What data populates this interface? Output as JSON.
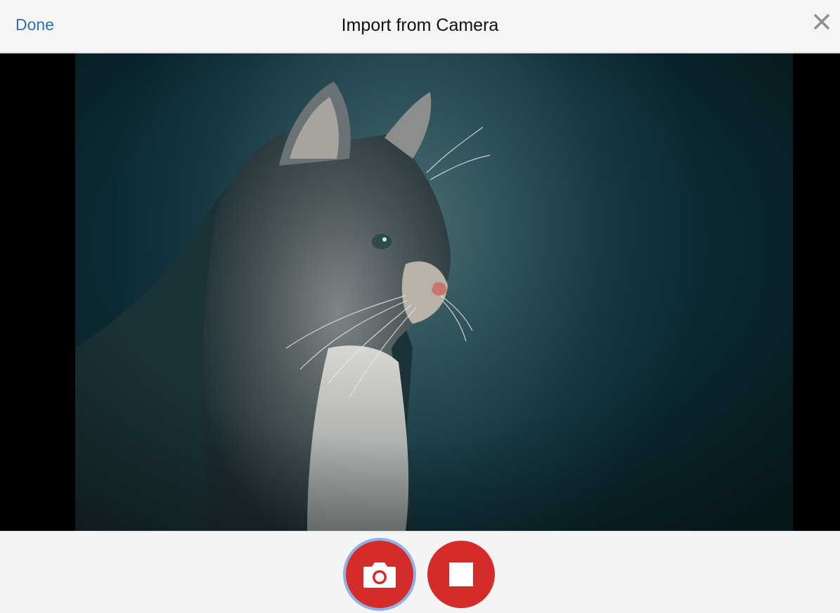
{
  "header": {
    "done_label": "Done",
    "title": "Import from Camera",
    "close_icon": "close-icon"
  },
  "preview": {
    "subject": "camera-preview-image"
  },
  "controls": {
    "capture_icon": "camera-icon",
    "stop_icon": "stop-icon",
    "accent_color": "#d42b2b",
    "focus_ring_color": "#8fb1e4"
  }
}
